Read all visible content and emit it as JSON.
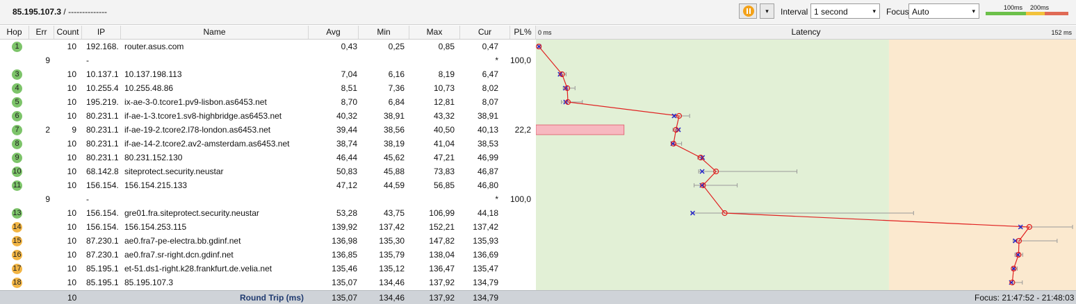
{
  "header": {
    "target": "85.195.107.3",
    "separator": "/",
    "description": "--------------",
    "dropdown_glyph": "▾",
    "interval_label": "Interval",
    "interval_value": "1 second",
    "focus_label": "Focus",
    "focus_value": "Auto",
    "scale_100": "100ms",
    "scale_200": "200ms",
    "scale_colors": [
      "#6cc04a",
      "#f2c23b",
      "#e06a55"
    ]
  },
  "columns": {
    "hop": "Hop",
    "err": "Err",
    "count": "Count",
    "ip": "IP",
    "name": "Name",
    "avg": "Avg",
    "min": "Min",
    "max": "Max",
    "cur": "Cur",
    "pl": "PL%",
    "latency": "Latency",
    "lat_min": "0 ms",
    "lat_max": "152 ms"
  },
  "hops": [
    {
      "hop": "1",
      "err": "",
      "count": "10",
      "ip": "192.168.",
      "name": "router.asus.com",
      "avg": "0,43",
      "min": "0,25",
      "max": "0,85",
      "cur": "0,47",
      "pl": "",
      "color": "#7dc46a",
      "avg_v": 0.43,
      "min_v": 0.25,
      "max_v": 0.85,
      "cur_v": 0.47
    },
    {
      "hop": "",
      "err": "9",
      "count": "",
      "ip": "-",
      "name": "",
      "avg": "",
      "min": "",
      "max": "",
      "cur": "*",
      "pl": "100,0",
      "color": "",
      "avg_v": null,
      "min_v": null,
      "max_v": null,
      "cur_v": null
    },
    {
      "hop": "3",
      "err": "",
      "count": "10",
      "ip": "10.137.1",
      "name": "10.137.198.113",
      "avg": "7,04",
      "min": "6,16",
      "max": "8,19",
      "cur": "6,47",
      "pl": "",
      "color": "#7dc46a",
      "avg_v": 7.04,
      "min_v": 6.16,
      "max_v": 8.19,
      "cur_v": 6.47
    },
    {
      "hop": "4",
      "err": "",
      "count": "10",
      "ip": "10.255.4",
      "name": "10.255.48.86",
      "avg": "8,51",
      "min": "7,36",
      "max": "10,73",
      "cur": "8,02",
      "pl": "",
      "color": "#7dc46a",
      "avg_v": 8.51,
      "min_v": 7.36,
      "max_v": 10.73,
      "cur_v": 8.02
    },
    {
      "hop": "5",
      "err": "",
      "count": "10",
      "ip": "195.219.",
      "name": "ix-ae-3-0.tcore1.pv9-lisbon.as6453.net",
      "avg": "8,70",
      "min": "6,84",
      "max": "12,81",
      "cur": "8,07",
      "pl": "",
      "color": "#7dc46a",
      "avg_v": 8.7,
      "min_v": 6.84,
      "max_v": 12.81,
      "cur_v": 8.07
    },
    {
      "hop": "6",
      "err": "",
      "count": "10",
      "ip": "80.231.1",
      "name": "if-ae-1-3.tcore1.sv8-highbridge.as6453.net",
      "avg": "40,32",
      "min": "38,91",
      "max": "43,32",
      "cur": "38,91",
      "pl": "",
      "color": "#7dc46a",
      "avg_v": 40.32,
      "min_v": 38.91,
      "max_v": 43.32,
      "cur_v": 38.91
    },
    {
      "hop": "7",
      "err": "2",
      "count": "9",
      "ip": "80.231.1",
      "name": "if-ae-19-2.tcore2.l78-london.as6453.net",
      "avg": "39,44",
      "min": "38,56",
      "max": "40,50",
      "cur": "40,13",
      "pl": "22,2",
      "color": "#7dc46a",
      "avg_v": 39.44,
      "min_v": 38.56,
      "max_v": 40.5,
      "cur_v": 40.13,
      "pl_v": 22.2
    },
    {
      "hop": "8",
      "err": "",
      "count": "10",
      "ip": "80.231.1",
      "name": "if-ae-14-2.tcore2.av2-amsterdam.as6453.net",
      "avg": "38,74",
      "min": "38,19",
      "max": "41,04",
      "cur": "38,53",
      "pl": "",
      "color": "#7dc46a",
      "avg_v": 38.74,
      "min_v": 38.19,
      "max_v": 41.04,
      "cur_v": 38.53
    },
    {
      "hop": "9",
      "err": "",
      "count": "10",
      "ip": "80.231.1",
      "name": "80.231.152.130",
      "avg": "46,44",
      "min": "45,62",
      "max": "47,21",
      "cur": "46,99",
      "pl": "",
      "color": "#7dc46a",
      "avg_v": 46.44,
      "min_v": 45.62,
      "max_v": 47.21,
      "cur_v": 46.99
    },
    {
      "hop": "10",
      "err": "",
      "count": "10",
      "ip": "68.142.8",
      "name": "siteprotect.security.neustar",
      "avg": "50,83",
      "min": "45,88",
      "max": "73,83",
      "cur": "46,87",
      "pl": "",
      "color": "#7dc46a",
      "avg_v": 50.83,
      "min_v": 45.88,
      "max_v": 73.83,
      "cur_v": 46.87
    },
    {
      "hop": "11",
      "err": "",
      "count": "10",
      "ip": "156.154.",
      "name": "156.154.215.133",
      "avg": "47,12",
      "min": "44,59",
      "max": "56,85",
      "cur": "46,80",
      "pl": "",
      "color": "#7dc46a",
      "avg_v": 47.12,
      "min_v": 44.59,
      "max_v": 56.85,
      "cur_v": 46.8
    },
    {
      "hop": "",
      "err": "9",
      "count": "",
      "ip": "-",
      "name": "",
      "avg": "",
      "min": "",
      "max": "",
      "cur": "*",
      "pl": "100,0",
      "color": "",
      "avg_v": null,
      "min_v": null,
      "max_v": null,
      "cur_v": null
    },
    {
      "hop": "13",
      "err": "",
      "count": "10",
      "ip": "156.154.",
      "name": "gre01.fra.siteprotect.security.neustar",
      "avg": "53,28",
      "min": "43,75",
      "max": "106,99",
      "cur": "44,18",
      "pl": "",
      "color": "#7dc46a",
      "avg_v": 53.28,
      "min_v": 43.75,
      "max_v": 106.99,
      "cur_v": 44.18
    },
    {
      "hop": "14",
      "err": "",
      "count": "10",
      "ip": "156.154.",
      "name": "156.154.253.115",
      "avg": "139,92",
      "min": "137,42",
      "max": "152,21",
      "cur": "137,42",
      "pl": "",
      "color": "#f2b544",
      "avg_v": 139.92,
      "min_v": 137.42,
      "max_v": 152.21,
      "cur_v": 137.42
    },
    {
      "hop": "15",
      "err": "",
      "count": "10",
      "ip": "87.230.1",
      "name": "ae0.fra7-pe-electra.bb.gdinf.net",
      "avg": "136,98",
      "min": "135,30",
      "max": "147,82",
      "cur": "135,93",
      "pl": "",
      "color": "#f2b544",
      "avg_v": 136.98,
      "min_v": 135.3,
      "max_v": 147.82,
      "cur_v": 135.93
    },
    {
      "hop": "16",
      "err": "",
      "count": "10",
      "ip": "87.230.1",
      "name": "ae0.fra7.sr-right.dcn.gdinf.net",
      "avg": "136,85",
      "min": "135,79",
      "max": "138,04",
      "cur": "136,69",
      "pl": "",
      "color": "#f2b544",
      "avg_v": 136.85,
      "min_v": 135.79,
      "max_v": 138.04,
      "cur_v": 136.69
    },
    {
      "hop": "17",
      "err": "",
      "count": "10",
      "ip": "85.195.1",
      "name": "et-51.ds1-right.k28.frankfurt.de.velia.net",
      "avg": "135,46",
      "min": "135,12",
      "max": "136,47",
      "cur": "135,47",
      "pl": "",
      "color": "#f2b544",
      "avg_v": 135.46,
      "min_v": 135.12,
      "max_v": 136.47,
      "cur_v": 135.47
    },
    {
      "hop": "18",
      "err": "",
      "count": "10",
      "ip": "85.195.1",
      "name": "85.195.107.3",
      "avg": "135,07",
      "min": "134,46",
      "max": "137,92",
      "cur": "134,79",
      "pl": "",
      "color": "#f2b544",
      "avg_v": 135.07,
      "min_v": 134.46,
      "max_v": 137.92,
      "cur_v": 134.79
    }
  ],
  "footer": {
    "count": "10",
    "label": "Round Trip (ms)",
    "avg": "135,07",
    "min": "134,46",
    "max": "137,92",
    "cur": "134,79",
    "focus": "Focus: 21:47:52 - 21:48:03"
  },
  "latency_scale": {
    "max_ms": 152,
    "zone_green_to_ms": 100,
    "zone_green_color": "#e2f0d6",
    "zone_orange_color": "#fbe9cf",
    "line_color": "#e02020",
    "cur_marker_color": "#2222cc",
    "loss_bar_color": "#f7b8c0"
  }
}
